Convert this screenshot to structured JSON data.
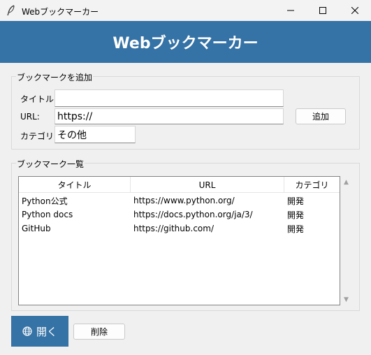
{
  "window": {
    "title": "Webブックマーカー"
  },
  "header": {
    "title": "Webブックマーカー"
  },
  "add_form": {
    "group_label": "ブックマークを追加",
    "title_label": "タイトル:",
    "title_value": "",
    "url_label": "URL:",
    "url_value": "https://",
    "category_label": "カテゴリ:",
    "category_value": "その他",
    "add_button": "追加"
  },
  "list": {
    "group_label": "ブックマーク一覧",
    "columns": [
      "タイトル",
      "URL",
      "カテゴリ"
    ],
    "rows": [
      {
        "title": "Python公式",
        "url": "https://www.python.org/",
        "category": "開発"
      },
      {
        "title": "Python docs",
        "url": "https://docs.python.org/ja/3/",
        "category": "開発"
      },
      {
        "title": "GitHub",
        "url": "https://github.com/",
        "category": "開発"
      }
    ]
  },
  "actions": {
    "open_label": "開く",
    "delete_label": "削除"
  },
  "icons": {
    "app": "feather-icon",
    "open": "globe-icon"
  },
  "colors": {
    "accent": "#3572a5",
    "background": "#f0f0f0"
  }
}
